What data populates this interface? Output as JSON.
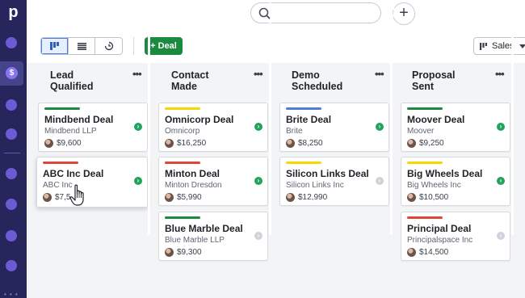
{
  "sidebar": {
    "logo": "p",
    "deals_icon": "$",
    "more": "• • •"
  },
  "topbar": {
    "search_icon": "search-icon",
    "add_label": "+"
  },
  "toolbar": {
    "views": [
      "kanban-view-icon",
      "list-view-icon",
      "forecast-view-icon"
    ],
    "deal_button": "+ Deal",
    "pipeline": "Sales"
  },
  "colors": {
    "sidebar": "#26265c",
    "accent": "#1a8a3f",
    "bar_green": "#1a8a3f",
    "bar_yellow": "#f5d800",
    "bar_red": "#e0453a",
    "bar_blue": "#4d7fd6"
  },
  "stages": [
    {
      "title": "Lead\nQualified",
      "menu": "•••",
      "cards": [
        {
          "title": "Mindbend Deal",
          "org": "Mindbend LLP",
          "amount": "$9,600",
          "bar": "green",
          "status": "go"
        },
        {
          "title": "ABC Inc Deal",
          "org": "ABC Inc",
          "amount": "$7,5",
          "bar": "red",
          "status": "go"
        }
      ]
    },
    {
      "title": "Contact\nMade",
      "menu": "•••",
      "cards": [
        {
          "title": "Omnicorp Deal",
          "org": "Omnicorp",
          "amount": "$16,250",
          "bar": "yellow",
          "status": "go"
        },
        {
          "title": "Minton Deal",
          "org": "Minton Dresdon",
          "amount": "$5,990",
          "bar": "red",
          "status": "go"
        },
        {
          "title": "Blue Marble Deal",
          "org": "Blue Marble LLP",
          "amount": "$9,300",
          "bar": "green",
          "status": "idle"
        }
      ]
    },
    {
      "title": "Demo\nScheduled",
      "menu": "•••",
      "cards": [
        {
          "title": "Brite Deal",
          "org": "Brite",
          "amount": "$8,250",
          "bar": "blue",
          "status": "go"
        },
        {
          "title": "Silicon Links Deal",
          "org": "Silicon Links Inc",
          "amount": "$12,990",
          "bar": "yellow",
          "status": "idle"
        }
      ]
    },
    {
      "title": "Proposal\nSent",
      "menu": "•••",
      "cards": [
        {
          "title": "Moover Deal",
          "org": "Moover",
          "amount": "$9,250",
          "bar": "green",
          "status": "go"
        },
        {
          "title": "Big Wheels Deal",
          "org": "Big Wheels Inc",
          "amount": "$10,500",
          "bar": "yellow",
          "status": "go"
        },
        {
          "title": "Principal Deal",
          "org": "Principalspace Inc",
          "amount": "$14,500",
          "bar": "red",
          "status": "idle"
        }
      ]
    }
  ]
}
